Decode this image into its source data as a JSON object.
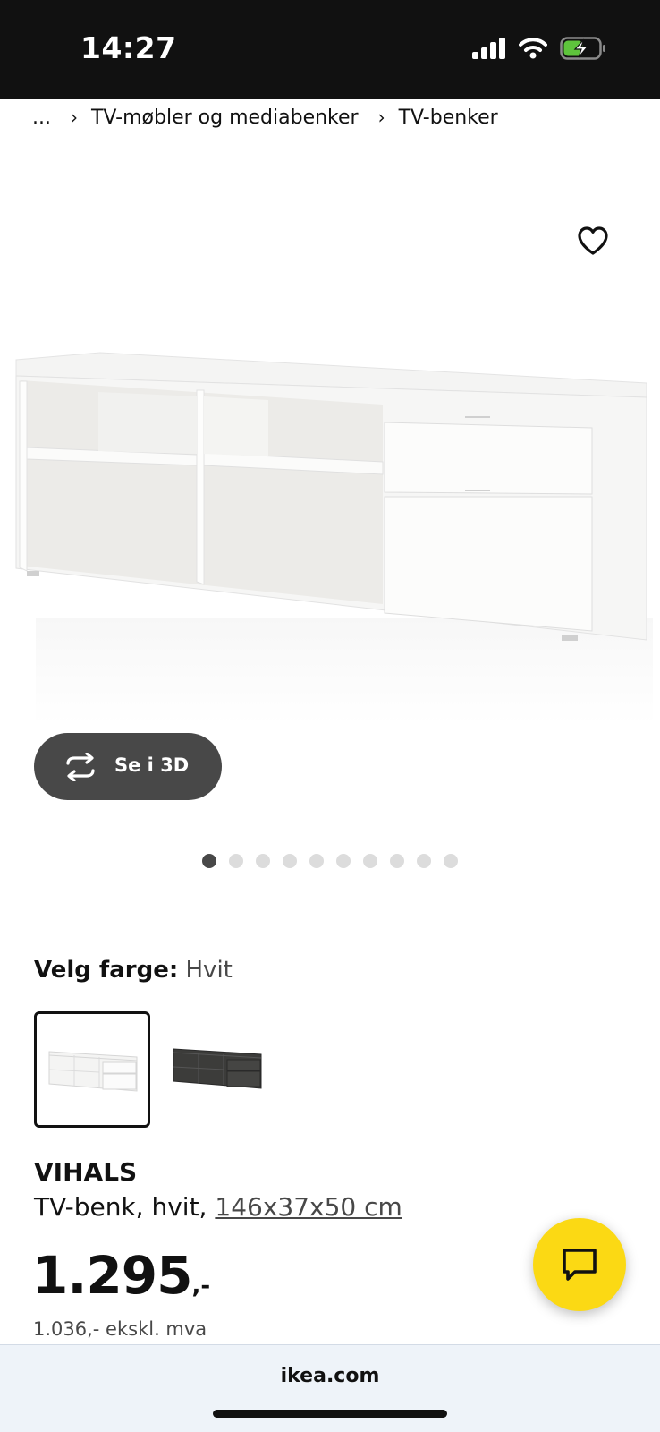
{
  "status_bar": {
    "time": "14:27",
    "icons": [
      "cellular-signal-icon",
      "wifi-icon",
      "battery-charging-icon"
    ],
    "battery_color": "#5ec43c"
  },
  "breadcrumb": {
    "ellipsis": "...",
    "items": [
      "TV-møbler og mediabenker",
      "TV-benker"
    ]
  },
  "product": {
    "favorite_icon": "heart-icon",
    "image_icon": "tv-bench-white",
    "view_3d_label": "Se i 3D",
    "gallery": {
      "count": 10,
      "active_index": 0
    },
    "color": {
      "label": "Velg farge:",
      "selected": "Hvit",
      "options": [
        "tv-bench-white",
        "tv-bench-dark-grey"
      ]
    },
    "name": "VIHALS",
    "description": "TV-benk, hvit,",
    "size_link": "146x37x50 cm",
    "price": {
      "amount": "1.295",
      "suffix": ",-",
      "ex_vat": "1.036,- ekskl. mva"
    }
  },
  "chat": {
    "icon": "chat-bubble-icon",
    "color": "#fbd914"
  },
  "browser": {
    "url": "ikea.com"
  }
}
